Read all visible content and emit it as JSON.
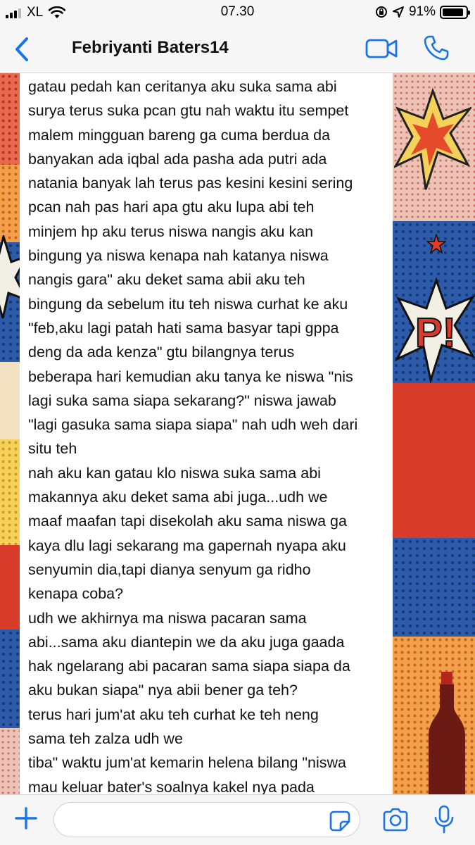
{
  "status_bar": {
    "carrier": "XL",
    "time": "07.30",
    "battery": "91%",
    "battery_level": 0.91,
    "icons": [
      "signal-icon",
      "wifi-icon",
      "orientation-lock-icon",
      "location-arrow-icon",
      "battery-icon"
    ]
  },
  "header": {
    "contact_name": "Febriyanti Baters14",
    "icons": [
      "back-chevron-icon",
      "video-call-icon",
      "phone-icon"
    ]
  },
  "message": {
    "lines": [
      "gatau pedah kan ceritanya aku suka sama abi",
      "surya terus suka pcan gtu nah waktu itu sempet",
      "malem mingguan bareng ga cuma berdua da",
      "banyakan ada iqbal ada pasha ada putri ada",
      "natania banyak lah terus pas kesini kesini sering",
      "pcan nah pas hari apa gtu aku lupa abi teh",
      "minjem hp aku terus niswa nangis aku kan",
      "bingung ya niswa kenapa nah katanya niswa",
      "nangis gara\" aku deket sama abii aku teh",
      "bingung da sebelum itu teh niswa curhat ke aku",
      "\"feb,aku lagi patah hati sama basyar tapi gppa",
      "deng da ada kenza\" gtu bilangnya terus",
      "beberapa hari kemudian aku tanya ke niswa \"nis",
      "lagi suka sama siapa sekarang?\" niswa jawab",
      "\"lagi gasuka sama siapa siapa\" nah udh weh dari",
      "situ teh",
      "nah aku kan gatau klo niswa suka sama abi",
      "makannya aku deket sama abi juga...udh we",
      "maaf maafan tapi disekolah aku sama niswa ga",
      "kaya dlu lagi sekarang ma gapernah nyapa aku",
      "senyumin dia,tapi dianya senyum ga ridho",
      "kenapa coba?",
      "udh we akhirnya ma niswa pacaran sama",
      "abi...sama aku diantepin we da aku juga gaada",
      "hak ngelarang abi pacaran sama siapa siapa da",
      "aku bukan siapa\" nya abii bener ga teh?",
      "terus hari jum'at aku teh curhat ke teh neng",
      "sama teh zalza udh we",
      "tiba\" waktu jum'at kemarin helena bilang \"niswa",
      "mau keluar bater's soalnya kakel nya pada"
    ]
  },
  "input_bar": {
    "value": "",
    "placeholder": "",
    "icons": [
      "plus-icon",
      "sticker-icon",
      "camera-icon",
      "microphone-icon"
    ]
  },
  "colors": {
    "accent": "#1a73e8",
    "bar_background": "#f6f6f6",
    "bubble": "#ffffff",
    "text": "#111111"
  }
}
